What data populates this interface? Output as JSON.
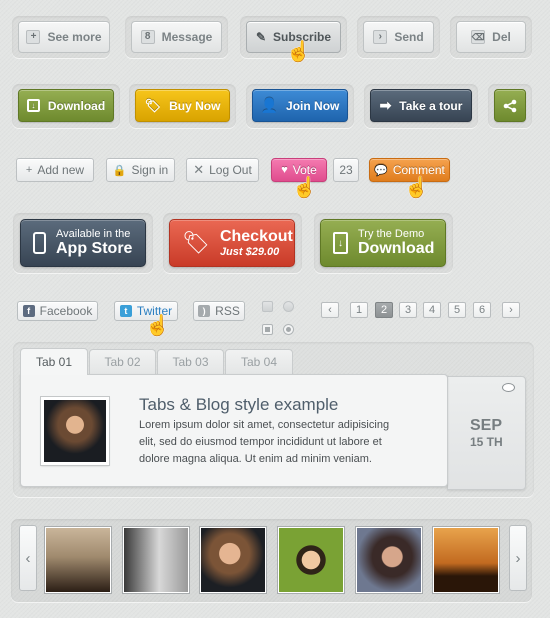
{
  "row1": {
    "see_more": {
      "label": "See more",
      "icon": "+"
    },
    "message": {
      "label": "Message",
      "icon": "8"
    },
    "subscribe": {
      "label": "Subscribe",
      "icon": "✎"
    },
    "send": {
      "label": "Send",
      "icon": "›"
    },
    "del": {
      "label": "Del",
      "icon": "⌫"
    }
  },
  "row2": {
    "download": {
      "label": "Download",
      "color": "#7d9a3c"
    },
    "buy_now": {
      "label": "Buy Now",
      "color": "#e9b60c"
    },
    "join_now": {
      "label": "Join Now",
      "color": "#2a74c2"
    },
    "take_tour": {
      "label": "Take a tour",
      "color": "#465566"
    },
    "share": {
      "color": "#7d9a3c"
    }
  },
  "row3": {
    "add_new": "Add new",
    "sign_in": "Sign in",
    "log_out": "Log Out",
    "vote": "Vote",
    "vote_count": "23",
    "comment": "Comment"
  },
  "row4": {
    "app_store": {
      "line1": "Available in the",
      "line2": "App Store"
    },
    "checkout": {
      "line1": "Checkout",
      "line2": "Just $29.00"
    },
    "demo": {
      "line1": "Try the Demo",
      "line2": "Download"
    }
  },
  "social": {
    "facebook": "Facebook",
    "twitter": "Twitter",
    "rss": "RSS"
  },
  "pagination": {
    "prev": "‹",
    "next": "›",
    "pages": [
      "1",
      "2",
      "3",
      "4",
      "5",
      "6"
    ],
    "current": "2"
  },
  "tabs": [
    "Tab 01",
    "Tab 02",
    "Tab 03",
    "Tab 04"
  ],
  "blog": {
    "title": "Tabs & Blog style example",
    "body": "Lorem ipsum dolor sit amet, consectetur adipisicing elit, sed do eiusmod tempor incididunt ut labore et dolore magna aliqua. Ut enim ad minim veniam.",
    "month": "SEP",
    "day": "15 TH"
  },
  "gallery": {
    "prev": "‹",
    "next": "›"
  }
}
